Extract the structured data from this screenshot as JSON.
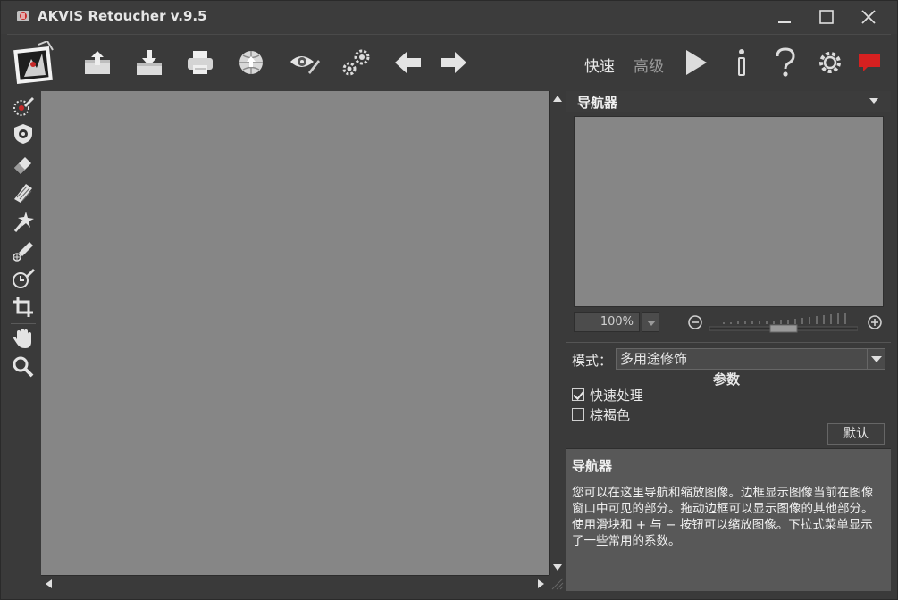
{
  "window": {
    "title": "AKVIS Retoucher v.9.5"
  },
  "toolbar": {
    "mode_express": "快速",
    "mode_advanced": "高级"
  },
  "navigator": {
    "title": "导航器",
    "zoom_value": "100%"
  },
  "settings": {
    "mode_label": "模式：",
    "mode_value": "多用途修饰",
    "params_title": "参数",
    "fast_processing": "快速处理",
    "sepia": "棕褐色",
    "default_button": "默认"
  },
  "help": {
    "title": "导航器",
    "text": "您可以在这里导航和缩放图像。边框显示图像当前在图像窗口中可见的部分。拖动边框可以显示图像的其他部分。使用滑块和 + 与 − 按钮可以缩放图像。下拉式菜单显示了一些常用的系数。"
  },
  "colors": {
    "background": "#3a3a3a",
    "canvas": "#868686",
    "help_bg": "#585858",
    "accent_red": "#d62020"
  }
}
